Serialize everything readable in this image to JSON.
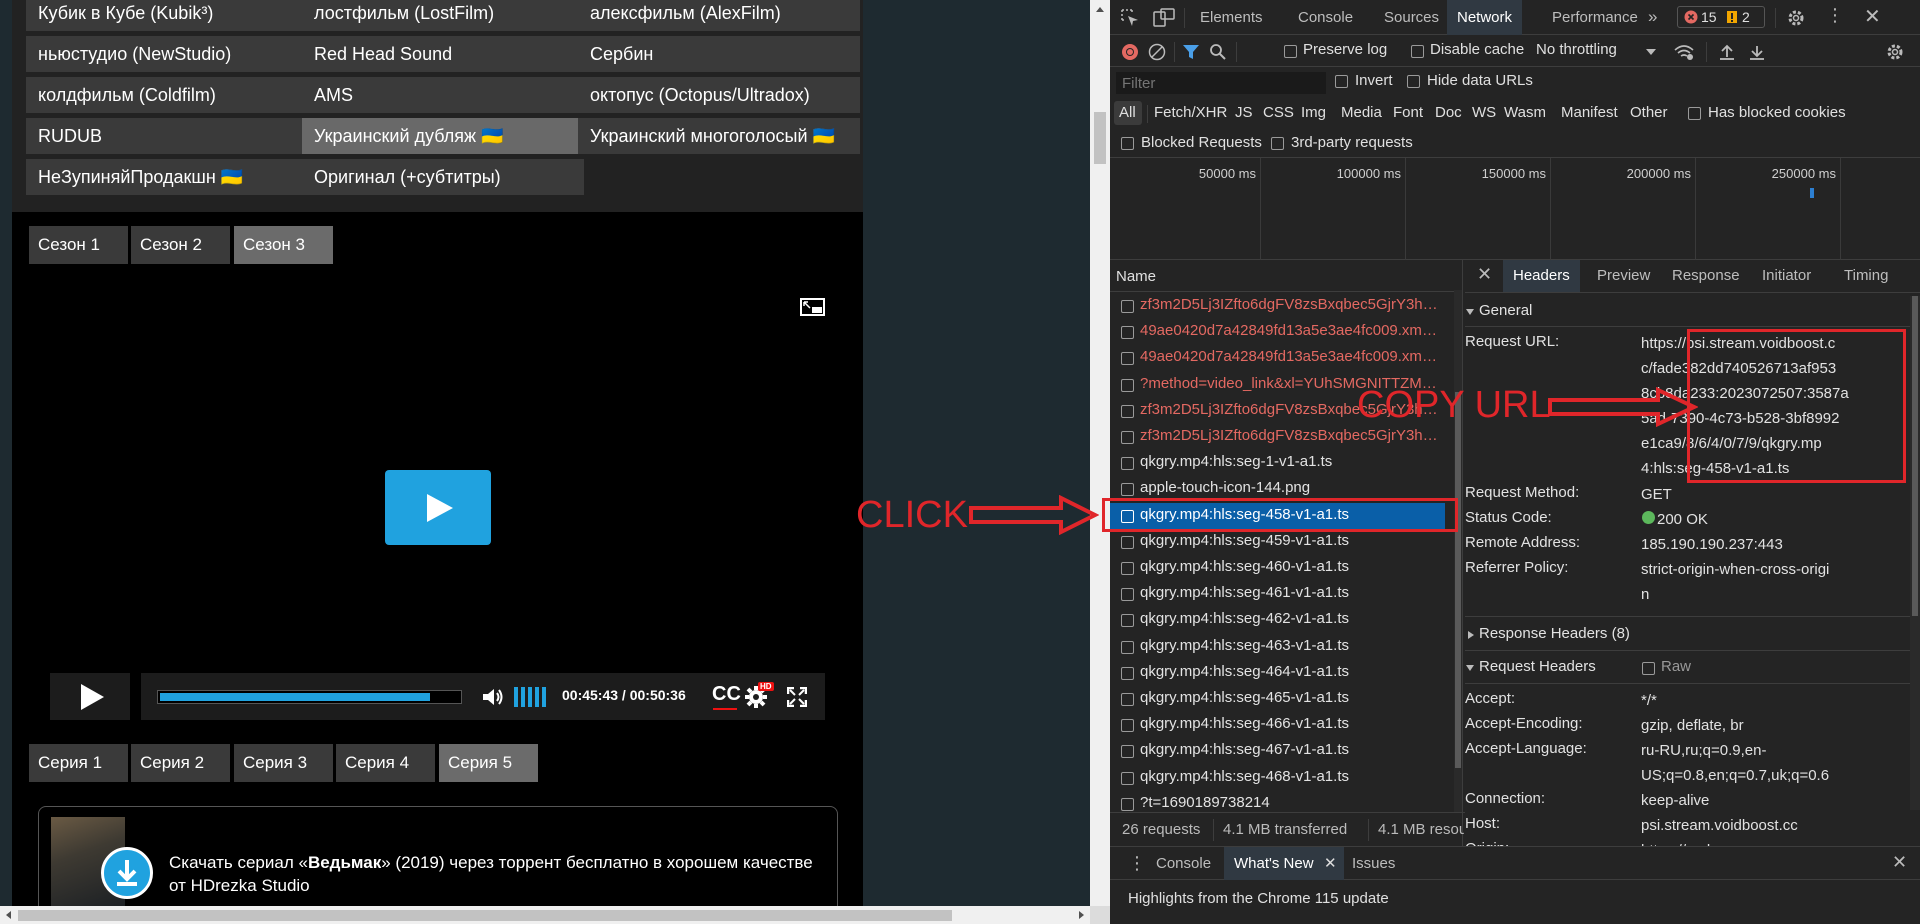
{
  "webpage": {
    "translators": [
      {
        "label": "Кубик в Кубе (Kubik³)",
        "active": false
      },
      {
        "label": "лостфильм (LostFilm)",
        "active": false
      },
      {
        "label": "алексфильм (AlexFilm)",
        "active": false
      },
      {
        "label": "ньюстудио (NewStudio)",
        "active": false
      },
      {
        "label": "Red Head Sound",
        "active": false
      },
      {
        "label": "Сербин",
        "active": false
      },
      {
        "label": "колдфильм (Coldfilm)",
        "active": false
      },
      {
        "label": "AMS",
        "active": false
      },
      {
        "label": "октопус (Octopus/Ultradox)",
        "active": false
      },
      {
        "label": "RUDUB",
        "active": false
      },
      {
        "label": "Украинский дубляж 🇺🇦",
        "active": true
      },
      {
        "label": "Украинский многоголосый 🇺🇦",
        "active": false
      },
      {
        "label": "НеЗупиняйПродакшн 🇺🇦",
        "active": false
      },
      {
        "label": "Оригинал (+субтитры)",
        "active": false
      }
    ],
    "seasons": [
      {
        "label": "Сезон 1",
        "active": false
      },
      {
        "label": "Сезон 2",
        "active": false
      },
      {
        "label": "Сезон 3",
        "active": true
      }
    ],
    "player": {
      "time": "00:45:43 / 00:50:36",
      "progress_fraction": 0.9,
      "volume_bars": 5,
      "cc_label": "CC",
      "hd_badge": "HD",
      "accent_color": "#20a2df"
    },
    "episodes": [
      {
        "label": "Серия 1",
        "active": false
      },
      {
        "label": "Серия 2",
        "active": false
      },
      {
        "label": "Серия 3",
        "active": false
      },
      {
        "label": "Серия 4",
        "active": false
      },
      {
        "label": "Серия 5",
        "active": true
      }
    ],
    "download": {
      "text_prefix": "Скачать сериал «",
      "text_bold": "Ведьмак",
      "text_suffix": "» (2019) через торрент бесплатно в хорошем качестве от HDrezka Studio"
    }
  },
  "devtools": {
    "tabs": [
      "Elements",
      "Console",
      "Sources",
      "Network",
      "Performance"
    ],
    "active_tab": "Network",
    "errors_count": "15",
    "warnings_count": "2",
    "toolbar": {
      "preserve_log": "Preserve log",
      "disable_cache": "Disable cache",
      "throttling": "No throttling"
    },
    "filter": {
      "placeholder": "Filter",
      "invert": "Invert",
      "hide_data_urls": "Hide data URLs"
    },
    "type_filters": [
      "All",
      "Fetch/XHR",
      "JS",
      "CSS",
      "Img",
      "Media",
      "Font",
      "Doc",
      "WS",
      "Wasm",
      "Manifest",
      "Other"
    ],
    "has_blocked_cookies": "Has blocked cookies",
    "blocked_requests": "Blocked Requests",
    "third_party": "3rd-party requests",
    "timeline_labels": [
      "50000 ms",
      "100000 ms",
      "150000 ms",
      "200000 ms",
      "250000 ms"
    ],
    "name_header": "Name",
    "requests": [
      {
        "name": "zf3m2D5Lj3IZfto6dgFV8zsBxqbec5GjrY3hP49...",
        "error": true
      },
      {
        "name": "49ae0420d7a42849fd13a5e3ae4fc009.xml?v...",
        "error": true
      },
      {
        "name": "49ae0420d7a42849fd13a5e3ae4fc009.xml?v...",
        "error": true
      },
      {
        "name": "?method=video_link&xl=YUhSMGNITTZMeTl...",
        "error": true
      },
      {
        "name": "zf3m2D5Lj3IZfto6dgFV8zsBxqbec5GjrY3hP49...",
        "error": true
      },
      {
        "name": "zf3m2D5Lj3IZfto6dgFV8zsBxqbec5GjrY3hP49...",
        "error": true
      },
      {
        "name": "qkgry.mp4:hls:seg-1-v1-a1.ts",
        "error": false
      },
      {
        "name": "apple-touch-icon-144.png",
        "error": false
      },
      {
        "name": "qkgry.mp4:hls:seg-458-v1-a1.ts",
        "error": false,
        "selected": true
      },
      {
        "name": "qkgry.mp4:hls:seg-459-v1-a1.ts",
        "error": false
      },
      {
        "name": "qkgry.mp4:hls:seg-460-v1-a1.ts",
        "error": false
      },
      {
        "name": "qkgry.mp4:hls:seg-461-v1-a1.ts",
        "error": false
      },
      {
        "name": "qkgry.mp4:hls:seg-462-v1-a1.ts",
        "error": false
      },
      {
        "name": "qkgry.mp4:hls:seg-463-v1-a1.ts",
        "error": false
      },
      {
        "name": "qkgry.mp4:hls:seg-464-v1-a1.ts",
        "error": false
      },
      {
        "name": "qkgry.mp4:hls:seg-465-v1-a1.ts",
        "error": false
      },
      {
        "name": "qkgry.mp4:hls:seg-466-v1-a1.ts",
        "error": false
      },
      {
        "name": "qkgry.mp4:hls:seg-467-v1-a1.ts",
        "error": false
      },
      {
        "name": "qkgry.mp4:hls:seg-468-v1-a1.ts",
        "error": false
      },
      {
        "name": "?t=1690189738214",
        "error": false
      }
    ],
    "status": {
      "requests": "26 requests",
      "transferred": "4.1 MB transferred",
      "resources": "4.1 MB resour"
    },
    "detail_tabs": [
      "Headers",
      "Preview",
      "Response",
      "Initiator",
      "Timing"
    ],
    "active_detail_tab": "Headers",
    "general": {
      "title": "General",
      "request_url_label": "Request URL:",
      "request_url_lines": [
        "https://psi.stream.voidboost.c",
        "c/fade382dd740526713af953",
        "8cb8da233:2023072507:3587a",
        "5ad-7390-4c73-b528-3bf8992",
        "e1ca9/8/6/4/0/7/9/qkgry.mp",
        "4:hls:seg-458-v1-a1.ts"
      ],
      "method_label": "Request Method:",
      "method": "GET",
      "status_label": "Status Code:",
      "status": "200 OK",
      "remote_label": "Remote Address:",
      "remote": "185.190.190.237:443",
      "referrer_label": "Referrer Policy:",
      "referrer_lines": [
        "strict-origin-when-cross-origi",
        "n"
      ]
    },
    "response_headers_title": "Response Headers (8)",
    "request_headers_title": "Request Headers",
    "raw_label": "Raw",
    "request_headers": [
      {
        "k": "Accept:",
        "v": "*/*"
      },
      {
        "k": "Accept-Encoding:",
        "v": "gzip, deflate, br"
      },
      {
        "k": "Accept-Language:",
        "v": "ru-RU,ru;q=0.9,en-"
      },
      {
        "k": "",
        "v": "US;q=0.8,en;q=0.7,uk;q=0.6"
      },
      {
        "k": "Connection:",
        "v": "keep-alive"
      },
      {
        "k": "Host:",
        "v": "psi.stream.voidboost.cc"
      },
      {
        "k": "Origin:",
        "v": "https://rezka.ag"
      }
    ],
    "drawer": {
      "tabs": [
        "Console",
        "What's New",
        "Issues"
      ],
      "active": "What's New",
      "message": "Highlights from the Chrome 115 update"
    }
  },
  "annotations": {
    "click": "CLICK",
    "copy_url": "COPY URL",
    "color": "#e0262a"
  }
}
